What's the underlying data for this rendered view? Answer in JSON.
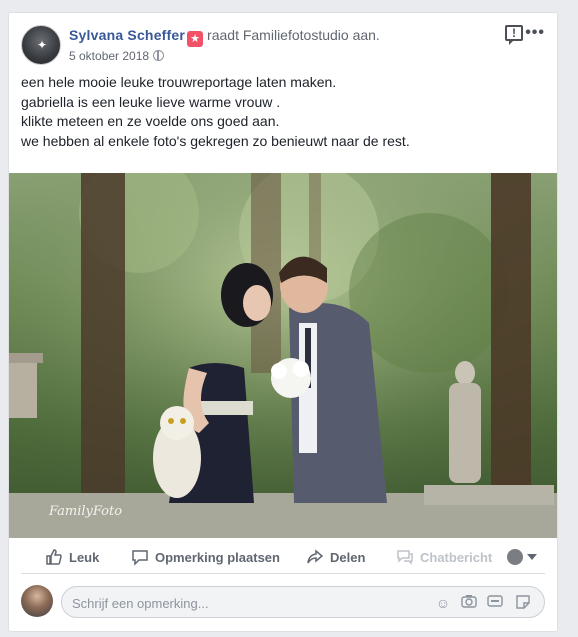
{
  "post": {
    "author": "Sylvana Scheffer",
    "action": "raadt Familiefotostudio aan.",
    "date": "5 oktober 2018",
    "badge_icon": "recommend-star-icon",
    "body_lines": [
      "een hele mooie leuke trouwreportage laten maken.",
      "gabriella is een leuke lieve warme vrouw .",
      "klikte meteen en ze voelde ons goed aan.",
      "we hebben al enkele foto's gekregen zo benieuwt naar de rest."
    ],
    "photo_watermark": "FamilyFoto"
  },
  "actions": {
    "like": "Leuk",
    "comment": "Opmerking plaatsen",
    "share": "Delen",
    "chat": "Chatbericht"
  },
  "comment": {
    "placeholder": "Schrijf een opmerking..."
  },
  "colors": {
    "author": "#385898",
    "badge": "#f25268",
    "background": "#e9ebee"
  }
}
